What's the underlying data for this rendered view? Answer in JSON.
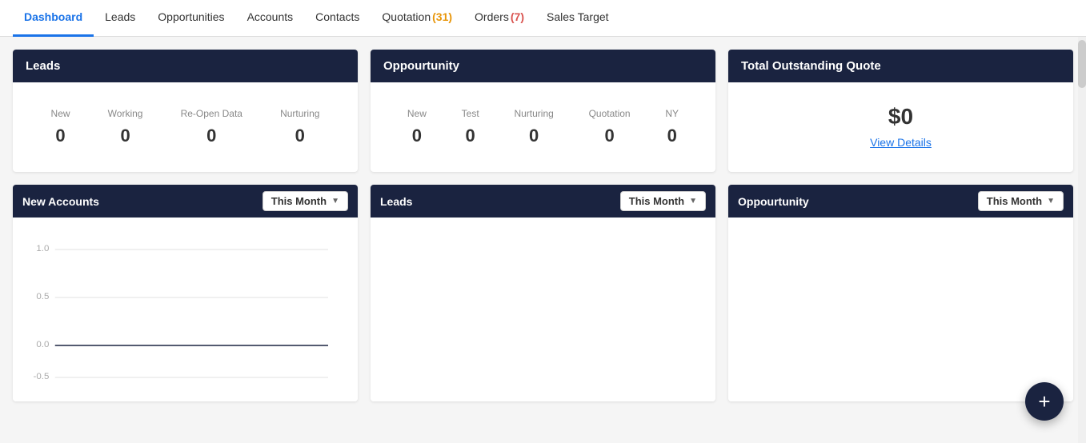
{
  "nav": {
    "items": [
      {
        "label": "Dashboard",
        "active": true,
        "badge": null
      },
      {
        "label": "Leads",
        "active": false,
        "badge": null
      },
      {
        "label": "Opportunities",
        "active": false,
        "badge": null
      },
      {
        "label": "Accounts",
        "active": false,
        "badge": null
      },
      {
        "label": "Contacts",
        "active": false,
        "badge": null
      },
      {
        "label": "Quotation",
        "active": false,
        "badge": "31",
        "badge_type": "orange"
      },
      {
        "label": "Orders",
        "active": false,
        "badge": "7",
        "badge_type": "red"
      },
      {
        "label": "Sales Target",
        "active": false,
        "badge": null
      }
    ]
  },
  "leads_card": {
    "title": "Leads",
    "stats": [
      {
        "label": "New",
        "value": "0"
      },
      {
        "label": "Working",
        "value": "0"
      },
      {
        "label": "Re-Open Data",
        "value": "0"
      },
      {
        "label": "Nurturing",
        "value": "0"
      }
    ]
  },
  "opportunity_card": {
    "title": "Oppourtunity",
    "stats": [
      {
        "label": "New",
        "value": "0"
      },
      {
        "label": "Test",
        "value": "0"
      },
      {
        "label": "Nurturing",
        "value": "0"
      },
      {
        "label": "Quotation",
        "value": "0"
      },
      {
        "label": "NY",
        "value": "0"
      }
    ]
  },
  "outstanding_card": {
    "title": "Total Outstanding Quote",
    "amount": "$0",
    "view_details_label": "View Details"
  },
  "new_accounts_card": {
    "title": "New Accounts",
    "dropdown_label": "This Month",
    "chart": {
      "y_labels": [
        "1.0",
        "0.5",
        "0.0",
        "-0.5"
      ],
      "y_values": [
        1.0,
        0.5,
        0.0,
        -0.5
      ]
    }
  },
  "leads_chart_card": {
    "title": "Leads",
    "dropdown_label": "This Month"
  },
  "opportunity_chart_card": {
    "title": "Oppourtunity",
    "dropdown_label": "This Month"
  },
  "fab": {
    "label": "+"
  }
}
